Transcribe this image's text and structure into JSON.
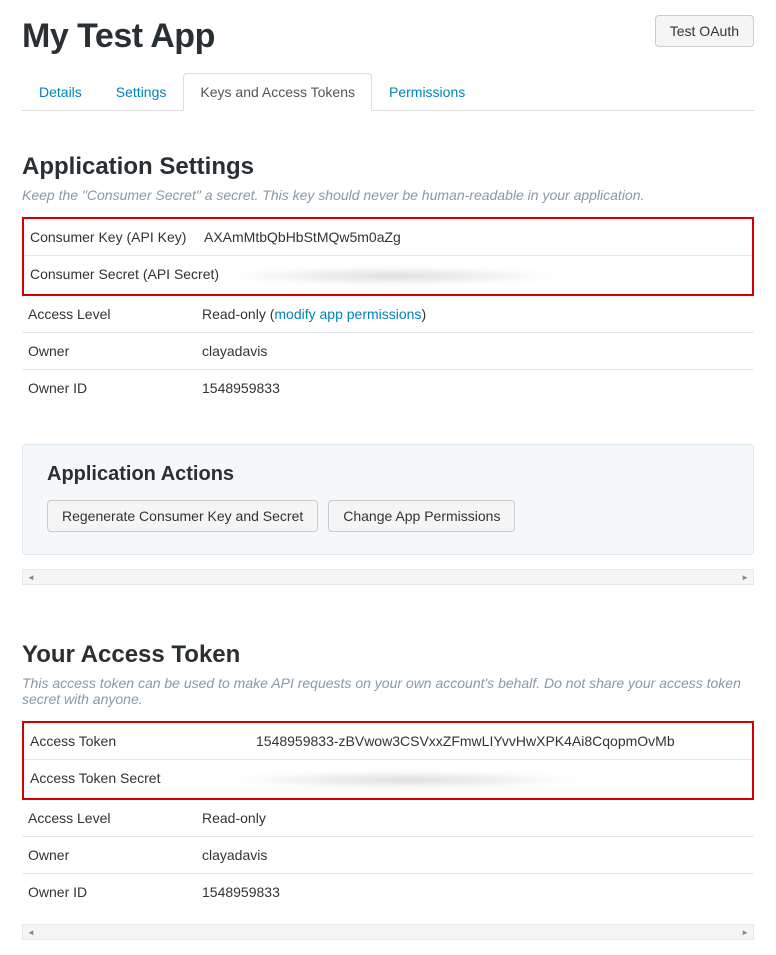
{
  "header": {
    "title": "My Test App",
    "test_button": "Test OAuth"
  },
  "tabs": {
    "items": [
      "Details",
      "Settings",
      "Keys and Access Tokens",
      "Permissions"
    ],
    "active_index": 2
  },
  "app_settings": {
    "heading": "Application Settings",
    "subtitle": "Keep the \"Consumer Secret\" a secret. This key should never be human-readable in your application.",
    "rows": {
      "consumer_key_label": "Consumer Key (API Key)",
      "consumer_key_value": "AXAmMtbQbHbStMQw5m0aZg",
      "consumer_secret_label": "Consumer Secret (API Secret)",
      "access_level_label": "Access Level",
      "access_level_value": "Read-only (",
      "access_level_link": "modify app permissions",
      "access_level_suffix": ")",
      "owner_label": "Owner",
      "owner_value": "clayadavis",
      "owner_id_label": "Owner ID",
      "owner_id_value": "1548959833"
    }
  },
  "app_actions": {
    "heading": "Application Actions",
    "regen_button": "Regenerate Consumer Key and Secret",
    "change_perms_button": "Change App Permissions"
  },
  "access_token": {
    "heading": "Your Access Token",
    "subtitle": "This access token can be used to make API requests on your own account's behalf. Do not share your access token secret with anyone.",
    "rows": {
      "token_label": "Access Token",
      "token_value": "1548959833-zBVwow3CSVxxZFmwLIYvvHwXPK4Ai8CqopmOvMb",
      "secret_label": "Access Token Secret",
      "access_level_label": "Access Level",
      "access_level_value": "Read-only",
      "owner_label": "Owner",
      "owner_value": "clayadavis",
      "owner_id_label": "Owner ID",
      "owner_id_value": "1548959833"
    }
  }
}
